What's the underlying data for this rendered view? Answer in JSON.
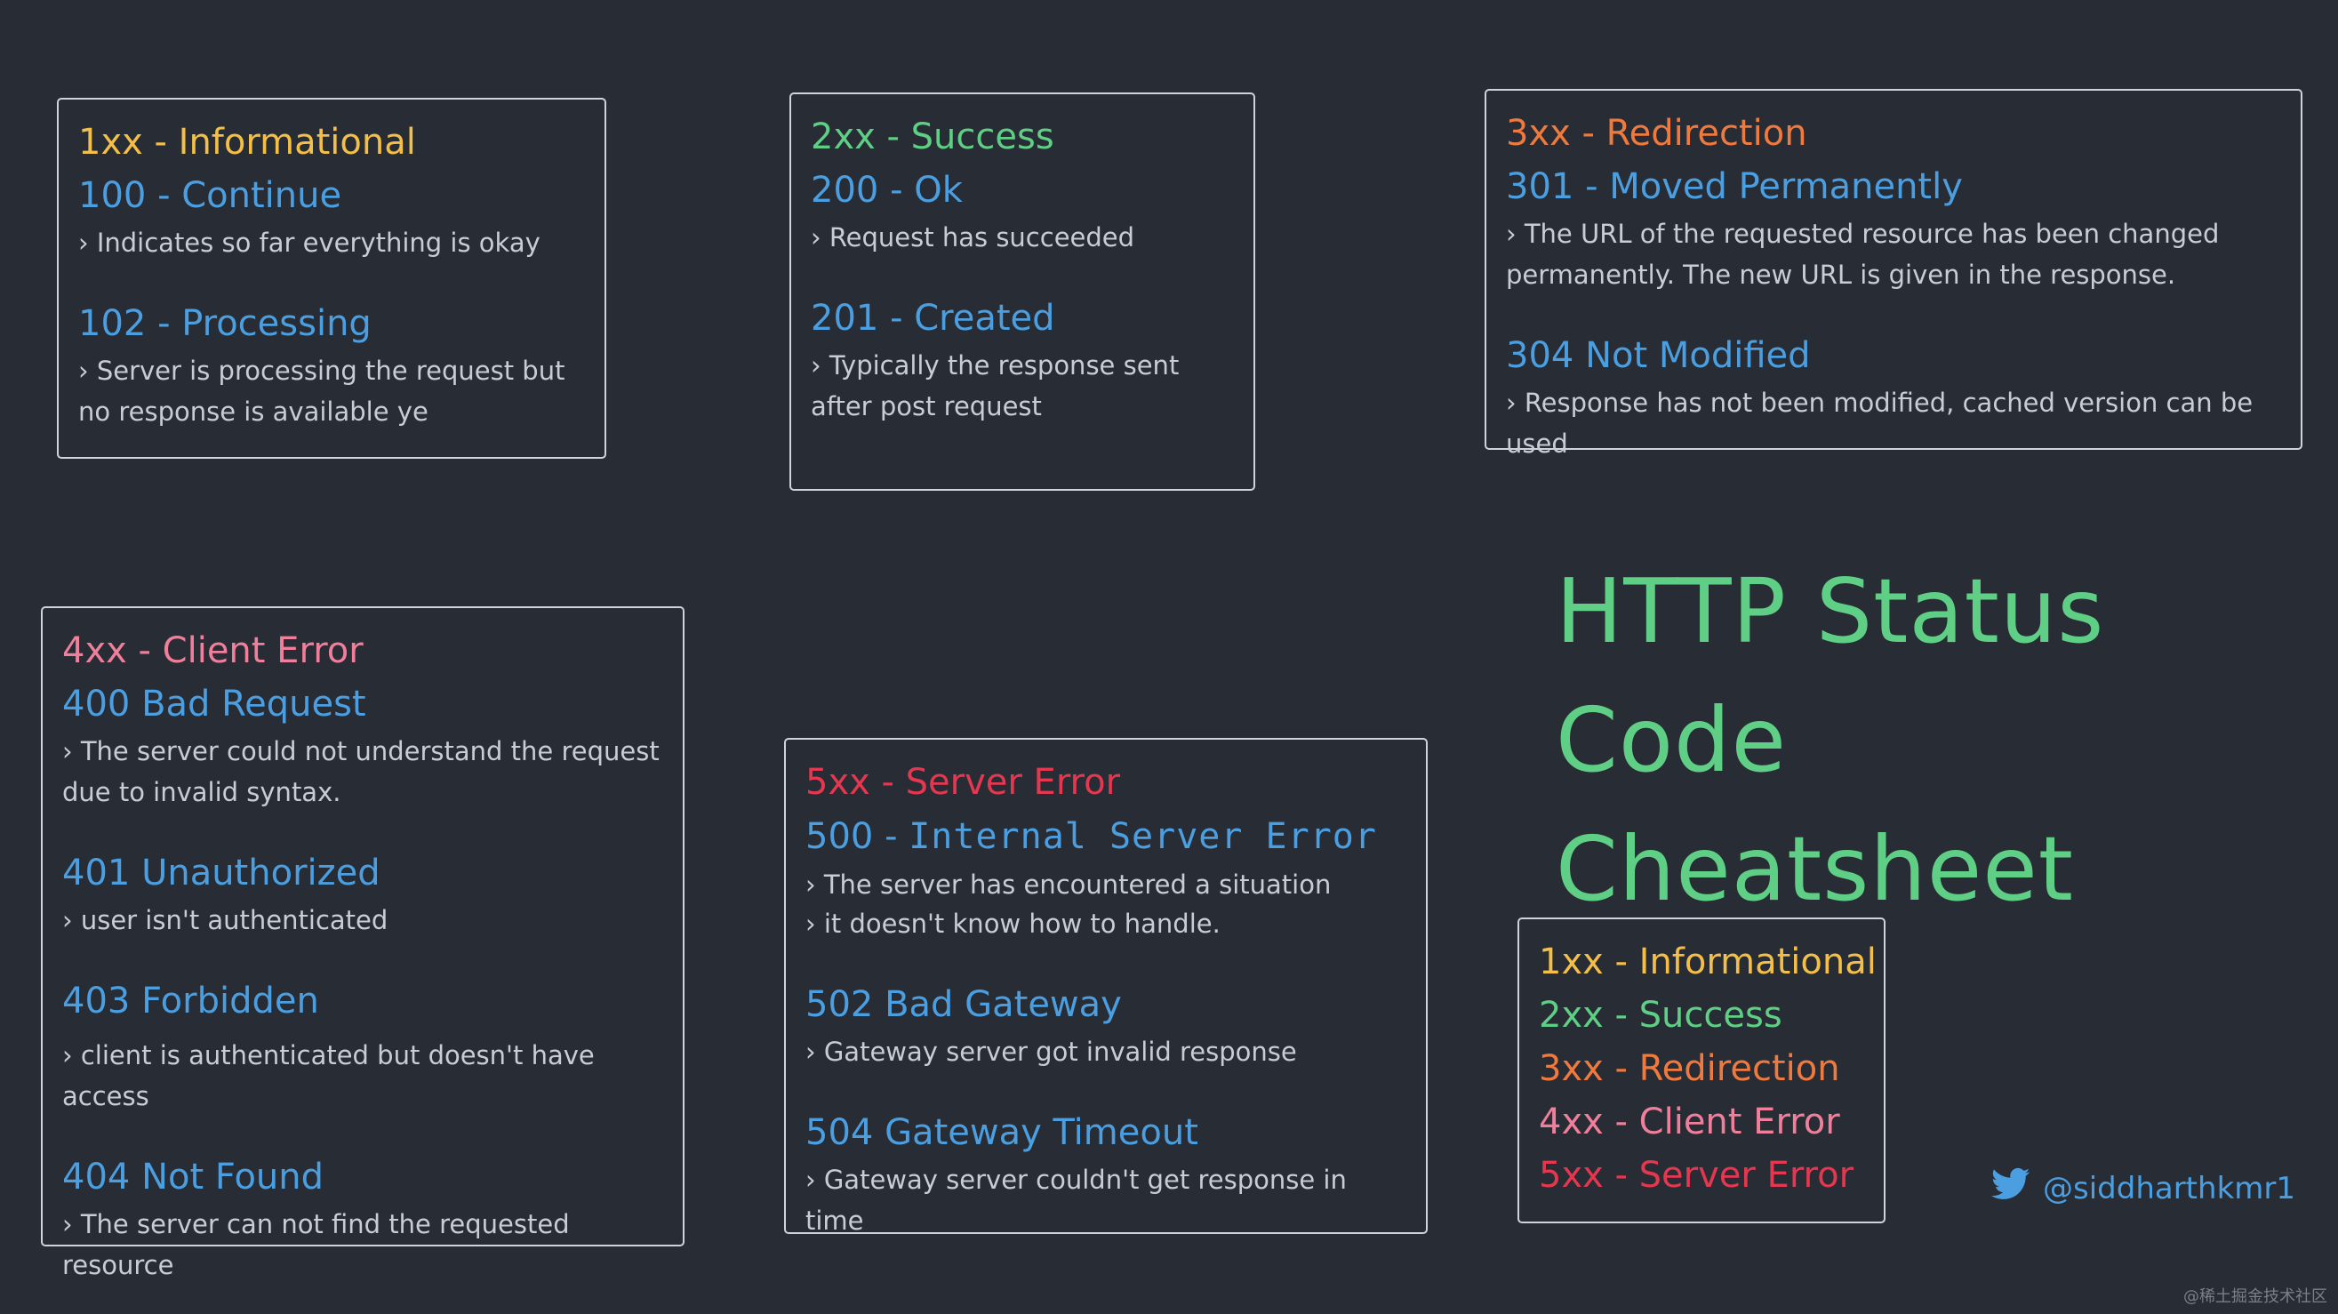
{
  "title": {
    "line1": "HTTP Status Code",
    "line2": "Cheatsheet"
  },
  "colors": {
    "background": "#282c34",
    "informational": "#f3bf48",
    "success": "#5fcf86",
    "redirection": "#ef7a3f",
    "client_error": "#ef7f9a",
    "server_error": "#e5374f",
    "code": "#4b9fe1",
    "title": "#5fcf86"
  },
  "box_1xx": {
    "category": "1xx - Informational",
    "items": [
      {
        "code": "100 - Continue",
        "desc": "Indicates so far everything is okay"
      },
      {
        "code": "102 - Processing",
        "desc": "Server is processing the request but no response is available ye"
      }
    ]
  },
  "box_2xx": {
    "category": "2xx - Success",
    "items": [
      {
        "code": "200 - Ok",
        "desc": "Request has succeeded"
      },
      {
        "code": "201 - Created",
        "desc": "Typically the response sent after post request"
      }
    ]
  },
  "box_3xx": {
    "category": "3xx - Redirection",
    "items": [
      {
        "code": "301 - Moved Permanently",
        "desc": "The URL of the requested resource has been changed permanently. The new URL is given in the response."
      },
      {
        "code": "304 Not Modified",
        "desc": "Response has not been modified, cached version can be used"
      }
    ]
  },
  "box_4xx": {
    "category": "4xx - Client Error",
    "items": [
      {
        "code": "400 Bad Request",
        "desc": "The server could not understand the request due to invalid syntax."
      },
      {
        "code": "401 Unauthorized",
        "desc": "user isn't authenticated"
      },
      {
        "code": "403 Forbidden",
        "desc": "client is authenticated but doesn't have access"
      },
      {
        "code": "404 Not Found",
        "desc": "The server can not find the requested resource"
      }
    ]
  },
  "box_5xx": {
    "category": "5xx - Server Error",
    "items": [
      {
        "code_prefix": "500 - ",
        "code_mono": "Internal Server Error",
        "desc_line1": "The server has encountered a situation",
        "desc_line2": "it doesn't know how to handle."
      },
      {
        "code": "502 Bad Gateway",
        "desc": "Gateway server got invalid response"
      },
      {
        "code": "504 Gateway Timeout",
        "desc": "Gateway server couldn't get response in time"
      }
    ]
  },
  "legend": {
    "items": [
      "1xx - Informational",
      "2xx - Success",
      "3xx - Redirection",
      "4xx - Client Error",
      "5xx - Server Error"
    ]
  },
  "handle": {
    "icon": "twitter-icon",
    "text": "@siddharthkmr1"
  },
  "watermark": "@稀土掘金技术社区"
}
